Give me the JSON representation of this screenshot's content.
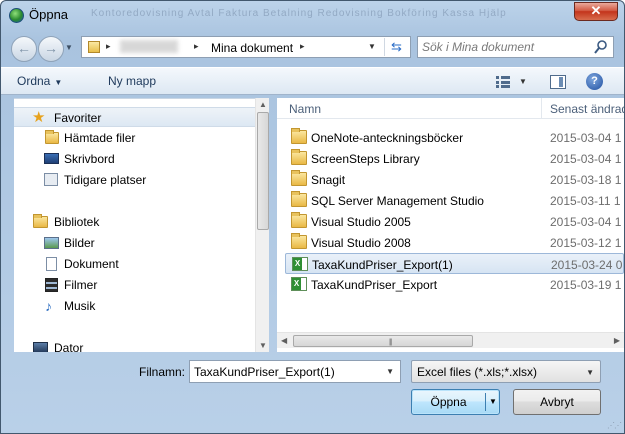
{
  "window": {
    "title": "Öppna",
    "behind_text": "Kontoredovisning   Avtal   Faktura   Betalning   Redovisning   Bokföring   Kassa   Hjälp"
  },
  "address_bar": {
    "crumb": "Mina dokument",
    "separator": "▸",
    "dropdown": "▼"
  },
  "search": {
    "placeholder": "Sök i Mina dokument"
  },
  "toolbar": {
    "organize_label": "Ordna",
    "new_folder_label": "Ny mapp"
  },
  "nav_tree": {
    "favorites": {
      "header": "Favoriter",
      "items": [
        {
          "label": "Hämtade filer",
          "icon": "downloads-folder-icon"
        },
        {
          "label": "Skrivbord",
          "icon": "desktop-icon"
        },
        {
          "label": "Tidigare platser",
          "icon": "recent-places-icon"
        }
      ]
    },
    "libraries": {
      "header": "Bibliotek",
      "items": [
        {
          "label": "Bilder",
          "icon": "pictures-icon"
        },
        {
          "label": "Dokument",
          "icon": "documents-icon"
        },
        {
          "label": "Filmer",
          "icon": "videos-icon"
        },
        {
          "label": "Musik",
          "icon": "music-icon"
        }
      ]
    },
    "computer": {
      "label": "Dator"
    }
  },
  "file_list": {
    "columns": {
      "name": "Namn",
      "date": "Senast ändrad"
    },
    "rows": [
      {
        "name": "OneNote-anteckningsböcker",
        "date": "2015-03-04 1",
        "type": "folder",
        "selected": false
      },
      {
        "name": "ScreenSteps Library",
        "date": "2015-03-04 1",
        "type": "folder",
        "selected": false
      },
      {
        "name": "Snagit",
        "date": "2015-03-18 1",
        "type": "folder",
        "selected": false
      },
      {
        "name": "SQL Server Management Studio",
        "date": "2015-03-11 1",
        "type": "folder",
        "selected": false
      },
      {
        "name": "Visual Studio 2005",
        "date": "2015-03-04 1",
        "type": "folder",
        "selected": false
      },
      {
        "name": "Visual Studio 2008",
        "date": "2015-03-12 1",
        "type": "folder",
        "selected": false
      },
      {
        "name": "TaxaKundPriser_Export(1)",
        "date": "2015-03-24 0",
        "type": "excel",
        "selected": true
      },
      {
        "name": "TaxaKundPriser_Export",
        "date": "2015-03-19 1",
        "type": "excel",
        "selected": false
      }
    ]
  },
  "bottom": {
    "filename_label": "Filnamn:",
    "filename_value": "TaxaKundPriser_Export(1)",
    "filter_value": "Excel files (*.xls;*.xlsx)",
    "open_label": "Öppna",
    "cancel_label": "Avbryt"
  },
  "colors": {
    "chrome": "#b9d0e8",
    "accent": "#3c7fb1",
    "selection": "#d6e4f3"
  }
}
